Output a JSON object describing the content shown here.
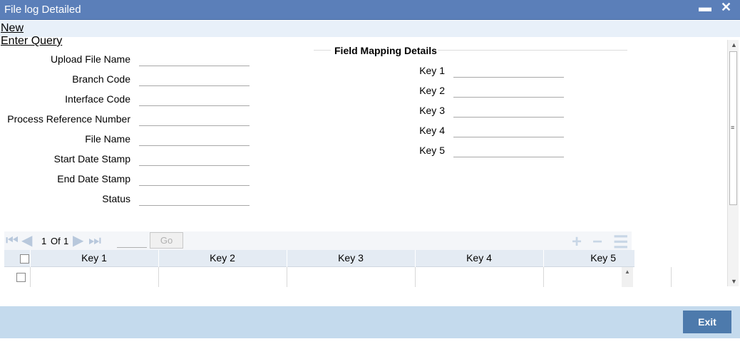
{
  "window": {
    "title": "File log Detailed",
    "minimize_glyph": "▬",
    "close_glyph": "✕"
  },
  "menu": {
    "new": "New",
    "enter_query": "Enter Query"
  },
  "left_fields": [
    {
      "label": "Upload File Name",
      "value": ""
    },
    {
      "label": "Branch Code",
      "value": ""
    },
    {
      "label": "Interface Code",
      "value": ""
    },
    {
      "label": "Process Reference Number",
      "value": ""
    },
    {
      "label": "File Name",
      "value": ""
    },
    {
      "label": "Start Date Stamp",
      "value": ""
    },
    {
      "label": "End Date Stamp",
      "value": ""
    },
    {
      "label": "Status",
      "value": ""
    }
  ],
  "field_mapping": {
    "legend": "Field Mapping Details",
    "keys": [
      {
        "label": "Key 1",
        "value": ""
      },
      {
        "label": "Key 2",
        "value": ""
      },
      {
        "label": "Key 3",
        "value": ""
      },
      {
        "label": "Key 4",
        "value": ""
      },
      {
        "label": "Key 5",
        "value": ""
      }
    ]
  },
  "pager": {
    "current": "1",
    "of_label": "Of",
    "total": "1",
    "go_label": "Go"
  },
  "grid": {
    "columns": [
      "Key 1",
      "Key 2",
      "Key 3",
      "Key 4",
      "Key 5"
    ],
    "rows": [
      [
        "",
        "",
        "",
        "",
        ""
      ]
    ]
  },
  "footer": {
    "exit_label": "Exit"
  },
  "colors": {
    "title_bar": "#5b7fb9",
    "footer": "#c4daed",
    "exit_button": "#4d7aac"
  }
}
